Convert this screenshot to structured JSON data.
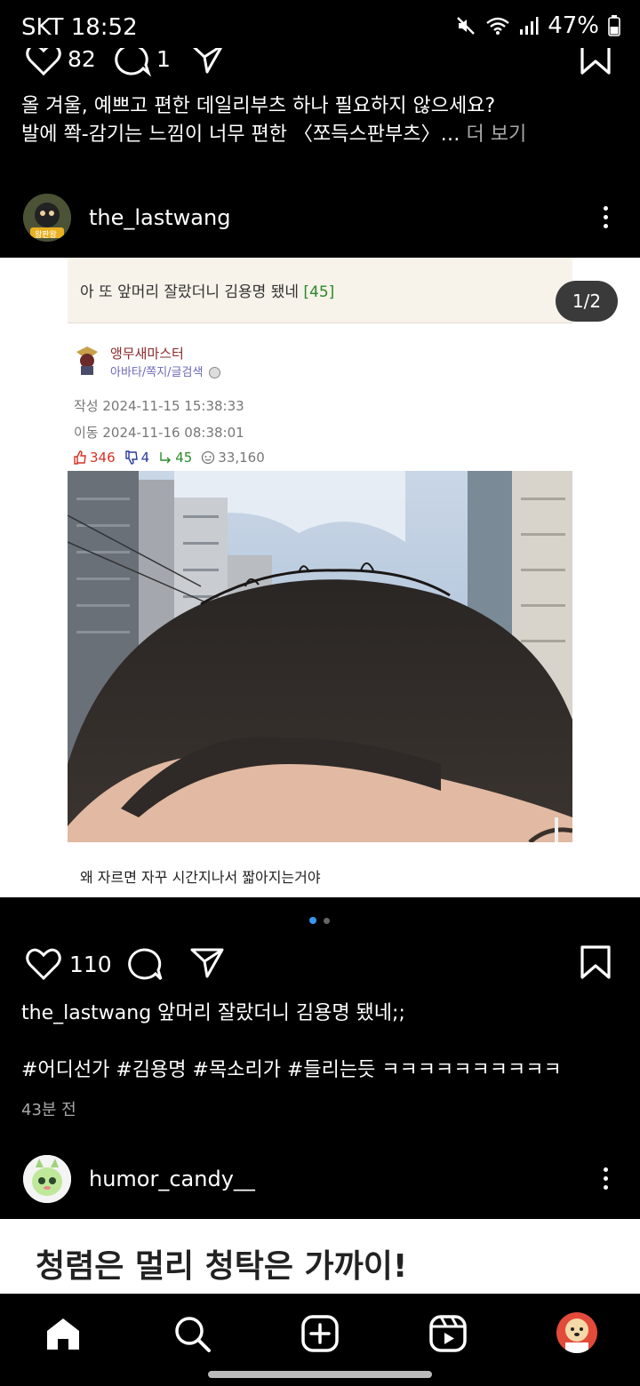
{
  "status_bar": {
    "carrier": "SKT",
    "time": "18:52",
    "battery": "47%"
  },
  "prev_post": {
    "likes": "82",
    "comments": "1",
    "caption_line1": "올 겨울, 예쁘고 편한 데일리부츠 하나 필요하지 않으세요?",
    "caption_line2": "발에 쫙-감기는 느낌이 너무 편한 〈쪼득스판부츠〉…",
    "more_label": "더 보기"
  },
  "post": {
    "username": "the_lastwang",
    "avatar_badge": "왕판왕",
    "page_counter": "1/2",
    "board": {
      "title": "아 또 앞머리 잘랐더니 김용명 됐네",
      "comment_count": "[45]",
      "author": "앵무새마스터",
      "author_links": "아바타/쪽지/글검색",
      "written": "작성 2024-11-15 15:38:33",
      "moved": "이동 2024-11-16 08:38:01",
      "upvotes": "346",
      "downvotes": "4",
      "replies": "45",
      "views": "33,160",
      "image_caption": "왜 자르면 자꾸 시간지나서 짧아지는거야"
    },
    "likes": "110",
    "caption_user": "the_lastwang",
    "caption_text": "앞머리 잘랐더니 김용명 됐네;;",
    "hashtags": "#어디선가 #김용명 #목소리가 #들리는듯 ㅋㅋㅋㅋㅋㅋㅋㅋㅋㅋ",
    "time_ago": "43분 전"
  },
  "next_post": {
    "username": "humor_candy__",
    "headline": "청렴은 멀리 청탁은 가까이!"
  },
  "nav": {
    "items": [
      "home-icon",
      "search-icon",
      "create-icon",
      "reels-icon",
      "profile-avatar"
    ]
  },
  "colors": {
    "accent_dot": "#3897f0",
    "like_red": "#d93025",
    "green": "#2a8a2a"
  }
}
